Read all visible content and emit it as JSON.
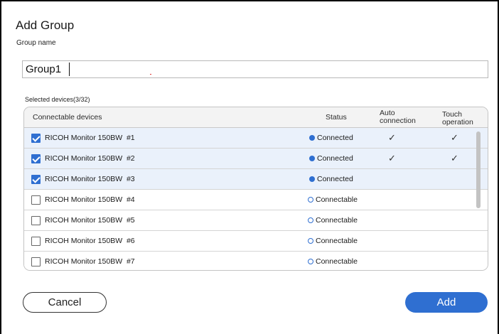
{
  "dialog": {
    "title": "Add Group",
    "group_name_label": "Group name",
    "group_name_value": "Group1",
    "selected_count": "Selected devices(3/32)"
  },
  "table": {
    "headers": {
      "devices": "Connectable devices",
      "status": "Status",
      "auto": "Auto connection",
      "touch": "Touch operation"
    },
    "rows": [
      {
        "name": "RICOH Monitor 150BW  #1",
        "checked": true,
        "status": "Connected",
        "auto": "✓",
        "touch": "✓"
      },
      {
        "name": "RICOH Monitor 150BW  #2",
        "checked": true,
        "status": "Connected",
        "auto": "✓",
        "touch": "✓"
      },
      {
        "name": "RICOH Monitor 150BW  #3",
        "checked": true,
        "status": "Connected",
        "auto": "",
        "touch": ""
      },
      {
        "name": "RICOH Monitor 150BW  #4",
        "checked": false,
        "status": "Connectable",
        "auto": "",
        "touch": ""
      },
      {
        "name": "RICOH Monitor 150BW  #5",
        "checked": false,
        "status": "Connectable",
        "auto": "",
        "touch": ""
      },
      {
        "name": "RICOH Monitor 150BW  #6",
        "checked": false,
        "status": "Connectable",
        "auto": "",
        "touch": ""
      },
      {
        "name": "RICOH Monitor 150BW  #7",
        "checked": false,
        "status": "Connectable",
        "auto": "",
        "touch": ""
      }
    ]
  },
  "buttons": {
    "cancel": "Cancel",
    "add": "Add"
  },
  "colors": {
    "accent": "#2f6fd1",
    "selected_row": "#eaf1fb"
  }
}
